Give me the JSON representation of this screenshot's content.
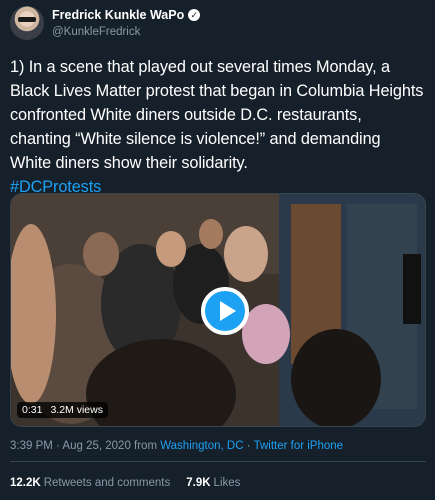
{
  "author": {
    "display_name": "Fredrick Kunkle WaPo",
    "handle": "@KunkleFredrick",
    "verified_glyph": "✓"
  },
  "tweet": {
    "text": "1) In a scene that played out several times Monday, a Black Lives Matter protest that began in Columbia Heights confronted White diners outside D.C. restaurants,  chanting “White silence is violence!” and demanding White diners show their solidarity.",
    "hashtag": "#DCProtests"
  },
  "video": {
    "duration": "0:31",
    "views": "3.2M views"
  },
  "meta": {
    "timestamp": "3:39 PM · Aug 25, 2020 from ",
    "location": "Washington, DC",
    "separator": " · ",
    "source": "Twitter for iPhone"
  },
  "stats": {
    "retweets_count": "12.2K",
    "retweets_label": "Retweets and comments",
    "likes_count": "7.9K",
    "likes_label": "Likes"
  },
  "colors": {
    "background": "#15202b",
    "accent": "#1da1f2",
    "secondary_text": "#8899a6",
    "border": "#38444d"
  }
}
